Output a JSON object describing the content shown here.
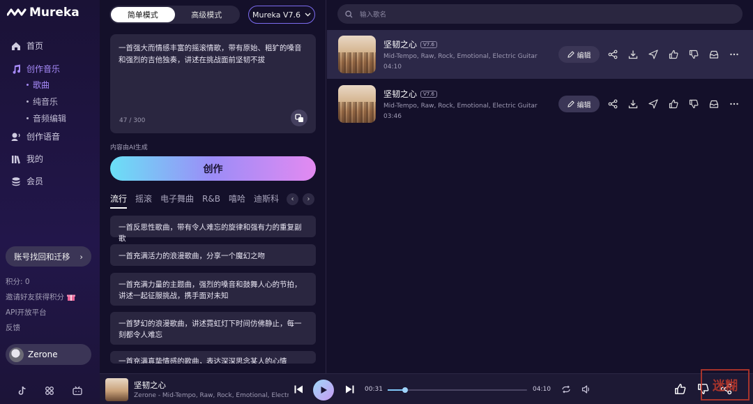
{
  "app": {
    "name": "Mureka"
  },
  "sidebar": {
    "nav": [
      {
        "label": "首页",
        "icon": "home-icon"
      },
      {
        "label": "创作音乐",
        "icon": "music-note-icon"
      },
      {
        "label": "创作语音",
        "icon": "voice-icon"
      },
      {
        "label": "我的",
        "icon": "library-icon"
      },
      {
        "label": "会员",
        "icon": "coins-icon"
      }
    ],
    "sub": [
      {
        "label": "歌曲"
      },
      {
        "label": "纯音乐"
      },
      {
        "label": "音频编辑"
      }
    ],
    "account_btn": "账号找回和迁移",
    "points": "积分: 0",
    "invite": "邀请好友获得积分",
    "api": "API开放平台",
    "feedback": "反馈",
    "user": "Zerone"
  },
  "creator": {
    "modes": [
      "简单模式",
      "高级模式"
    ],
    "version": "Mureka V7.6",
    "prompt": "一首强大而情感丰富的摇滚情歌，带有原始、粗犷的嗓音和强烈的吉他独奏，讲述在挑战面前坚韧不拔",
    "count": "47 / 300",
    "ai_note": "内容由AI生成",
    "create_label": "创作",
    "genres": [
      "流行",
      "摇滚",
      "电子舞曲",
      "R&B",
      "嘻哈",
      "迪斯科"
    ],
    "suggestions": [
      "一首反思性歌曲，带有令人难忘的旋律和强有力的重复副歌",
      "一首充满活力的浪漫歌曲，分享一个魔幻之吻",
      "一首充满力量的主题曲，强烈的嗓音和鼓舞人心的节拍，讲述一起征服挑战，携手面对未知",
      "一首梦幻的浪漫歌曲，讲述霓虹灯下时间仿佛静止，每一刻都令人难忘",
      "一首充满真挚情感的歌曲，表达深深思念某人的心情"
    ]
  },
  "search": {
    "placeholder": "输入歌名"
  },
  "songs": [
    {
      "title": "坚韧之心",
      "version": "V7.6",
      "tags": "Mid-Tempo, Raw, Rock, Emotional, Electric Guitar",
      "duration": "04:10",
      "edit": "编辑"
    },
    {
      "title": "坚韧之心",
      "version": "V7.6",
      "tags": "Mid-Tempo, Raw, Rock, Emotional, Electric Guitar",
      "duration": "03:46",
      "edit": "编辑"
    }
  ],
  "player": {
    "title": "坚韧之心",
    "subtitle": "Zerone - Mid-Tempo, Raw, Rock, Emotional, Electric Guitar",
    "current": "00:31",
    "total": "04:10",
    "progress": 0.124
  },
  "watermark": "迷糊"
}
